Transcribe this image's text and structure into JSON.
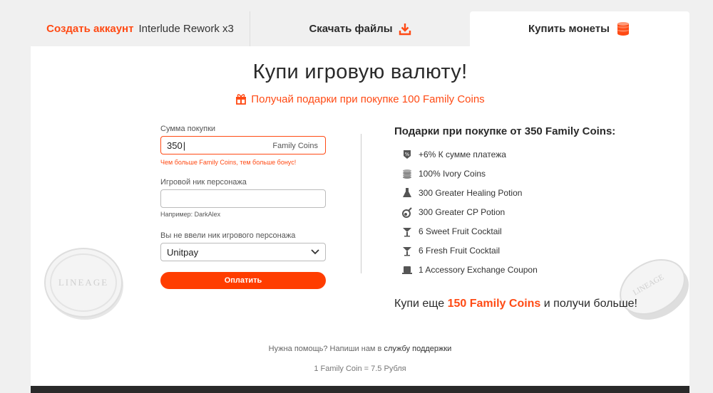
{
  "tabs": {
    "create_account": "Создать аккаунт",
    "server_name": "Interlude Rework x3",
    "download": "Скачать файлы",
    "buy_coins": "Купить монеты"
  },
  "main": {
    "title": "Купи игровую валюту!",
    "promo": "Получай подарки при покупке 100 Family Coins"
  },
  "form": {
    "amount_label": "Сумма покупки",
    "amount_value": "350",
    "amount_suffix": "Family Coins",
    "amount_hint": "Чем больше Family Coins, тем больше бонус!",
    "nick_label": "Игровой ник персонажа",
    "nick_value": "",
    "nick_hint": "Например: DarkAlex",
    "method_label": "Вы не ввели ник игрового персонажа",
    "method_value": "Unitpay",
    "pay_button": "Оплатить"
  },
  "gifts": {
    "title": "Подарки при покупке от 350 Family Coins:",
    "items": [
      {
        "icon": "percent-icon",
        "label": "+6% К сумме платежа"
      },
      {
        "icon": "coins-icon",
        "label": "100% Ivory Coins"
      },
      {
        "icon": "potion-icon",
        "label": "300 Greater Healing Potion"
      },
      {
        "icon": "flask-icon",
        "label": "300 Greater CP Potion"
      },
      {
        "icon": "cocktail-icon",
        "label": "6 Sweet Fruit Cocktail"
      },
      {
        "icon": "cocktail-icon",
        "label": "6 Fresh Fruit Cocktail"
      },
      {
        "icon": "coupon-icon",
        "label": "1 Accessory Exchange Coupon"
      }
    ],
    "cta_prefix": "Купи еще",
    "cta_amount": "150 Family Coins",
    "cta_suffix": "и получи больше!"
  },
  "footer": {
    "help_prefix": "Нужна помощь? Напиши нам в",
    "help_link": "службу поддержки",
    "rate": "1 Family Coin = 7.5 Рубля"
  },
  "coins": {
    "logo_text": "LINEAGE"
  },
  "colors": {
    "accent": "#ff4a14",
    "button": "#ff3d00"
  }
}
